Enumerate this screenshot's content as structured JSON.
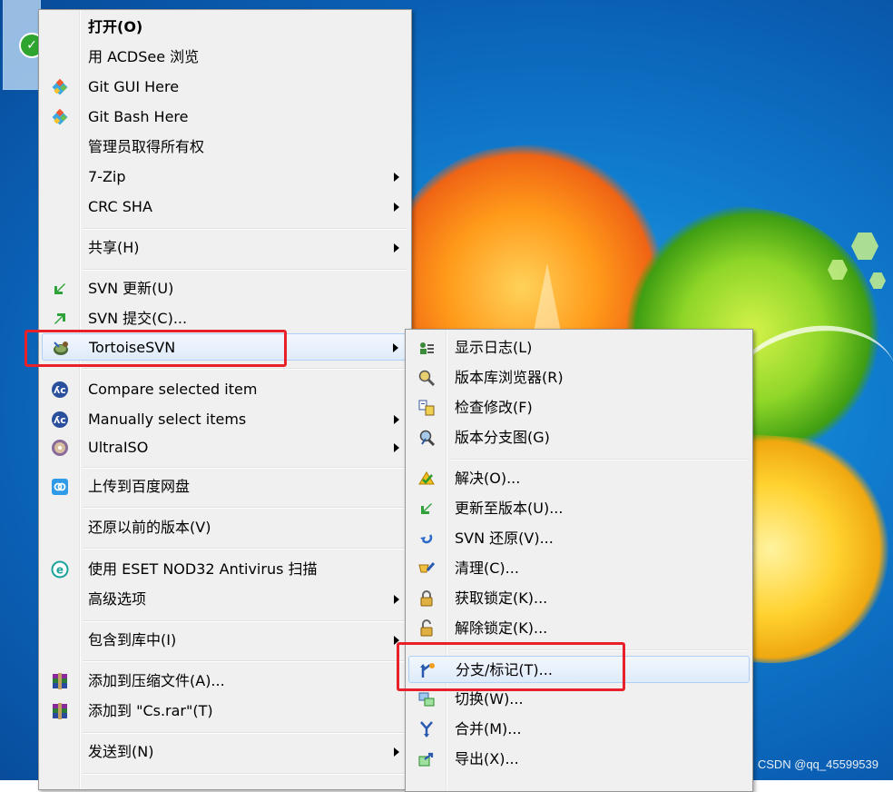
{
  "main_menu": {
    "items": [
      {
        "label": "打开(O)",
        "bold": true,
        "icon": "none"
      },
      {
        "label": "用 ACDSee 浏览",
        "icon": "none"
      },
      {
        "label": "Git GUI Here",
        "icon": "git-icon"
      },
      {
        "label": "Git Bash Here",
        "icon": "git-icon"
      },
      {
        "label": "管理员取得所有权",
        "icon": "none"
      },
      {
        "label": "7-Zip",
        "submenu": true,
        "icon": "none"
      },
      {
        "label": "CRC SHA",
        "submenu": true,
        "icon": "none"
      },
      {
        "label": "共享(H)",
        "submenu": true,
        "icon": "none"
      },
      {
        "label": "SVN 更新(U)",
        "icon": "svn-update-icon"
      },
      {
        "label": "SVN 提交(C)...",
        "icon": "svn-commit-icon"
      },
      {
        "label": "TortoiseSVN",
        "submenu": true,
        "icon": "tortoisesvn-icon"
      },
      {
        "label": "Compare selected item",
        "icon": "beyond-compare-icon"
      },
      {
        "label": "Manually select items",
        "submenu": true,
        "icon": "beyond-compare-icon"
      },
      {
        "label": "UltraISO",
        "submenu": true,
        "icon": "ultraiso-icon"
      },
      {
        "label": "上传到百度网盘",
        "icon": "baidu-netdisk-icon"
      },
      {
        "label": "还原以前的版本(V)",
        "icon": "none"
      },
      {
        "label": "使用 ESET NOD32 Antivirus 扫描",
        "icon": "eset-icon"
      },
      {
        "label": "高级选项",
        "submenu": true,
        "icon": "none"
      },
      {
        "label": "包含到库中(I)",
        "submenu": true,
        "icon": "none"
      },
      {
        "label": "添加到压缩文件(A)...",
        "icon": "winrar-icon"
      },
      {
        "label": "添加到 \"Cs.rar\"(T)",
        "icon": "winrar-icon"
      },
      {
        "label": "发送到(N)",
        "submenu": true,
        "icon": "none"
      }
    ]
  },
  "sub_menu": {
    "items": [
      {
        "label": "显示日志(L)",
        "icon": "show-log-icon"
      },
      {
        "label": "版本库浏览器(R)",
        "icon": "repo-browser-icon"
      },
      {
        "label": "检查修改(F)",
        "icon": "check-modifications-icon"
      },
      {
        "label": "版本分支图(G)",
        "icon": "revision-graph-icon"
      },
      {
        "label": "解决(O)...",
        "icon": "resolve-icon"
      },
      {
        "label": "更新至版本(U)...",
        "icon": "update-to-revision-icon"
      },
      {
        "label": "SVN 还原(V)...",
        "icon": "revert-icon"
      },
      {
        "label": "清理(C)...",
        "icon": "cleanup-icon"
      },
      {
        "label": "获取锁定(K)...",
        "icon": "lock-icon"
      },
      {
        "label": "解除锁定(K)...",
        "icon": "unlock-icon"
      },
      {
        "label": "分支/标记(T)...",
        "icon": "branch-tag-icon"
      },
      {
        "label": "切换(W)...",
        "icon": "switch-icon"
      },
      {
        "label": "合并(M)...",
        "icon": "merge-icon"
      },
      {
        "label": "导出(X)...",
        "icon": "export-icon"
      }
    ]
  },
  "watermark": "CSDN @qq_45599539",
  "colors": {
    "highlight_box": "#e8202a",
    "menu_bg": "#f0f0f0",
    "hover_border": "#aecff7"
  }
}
